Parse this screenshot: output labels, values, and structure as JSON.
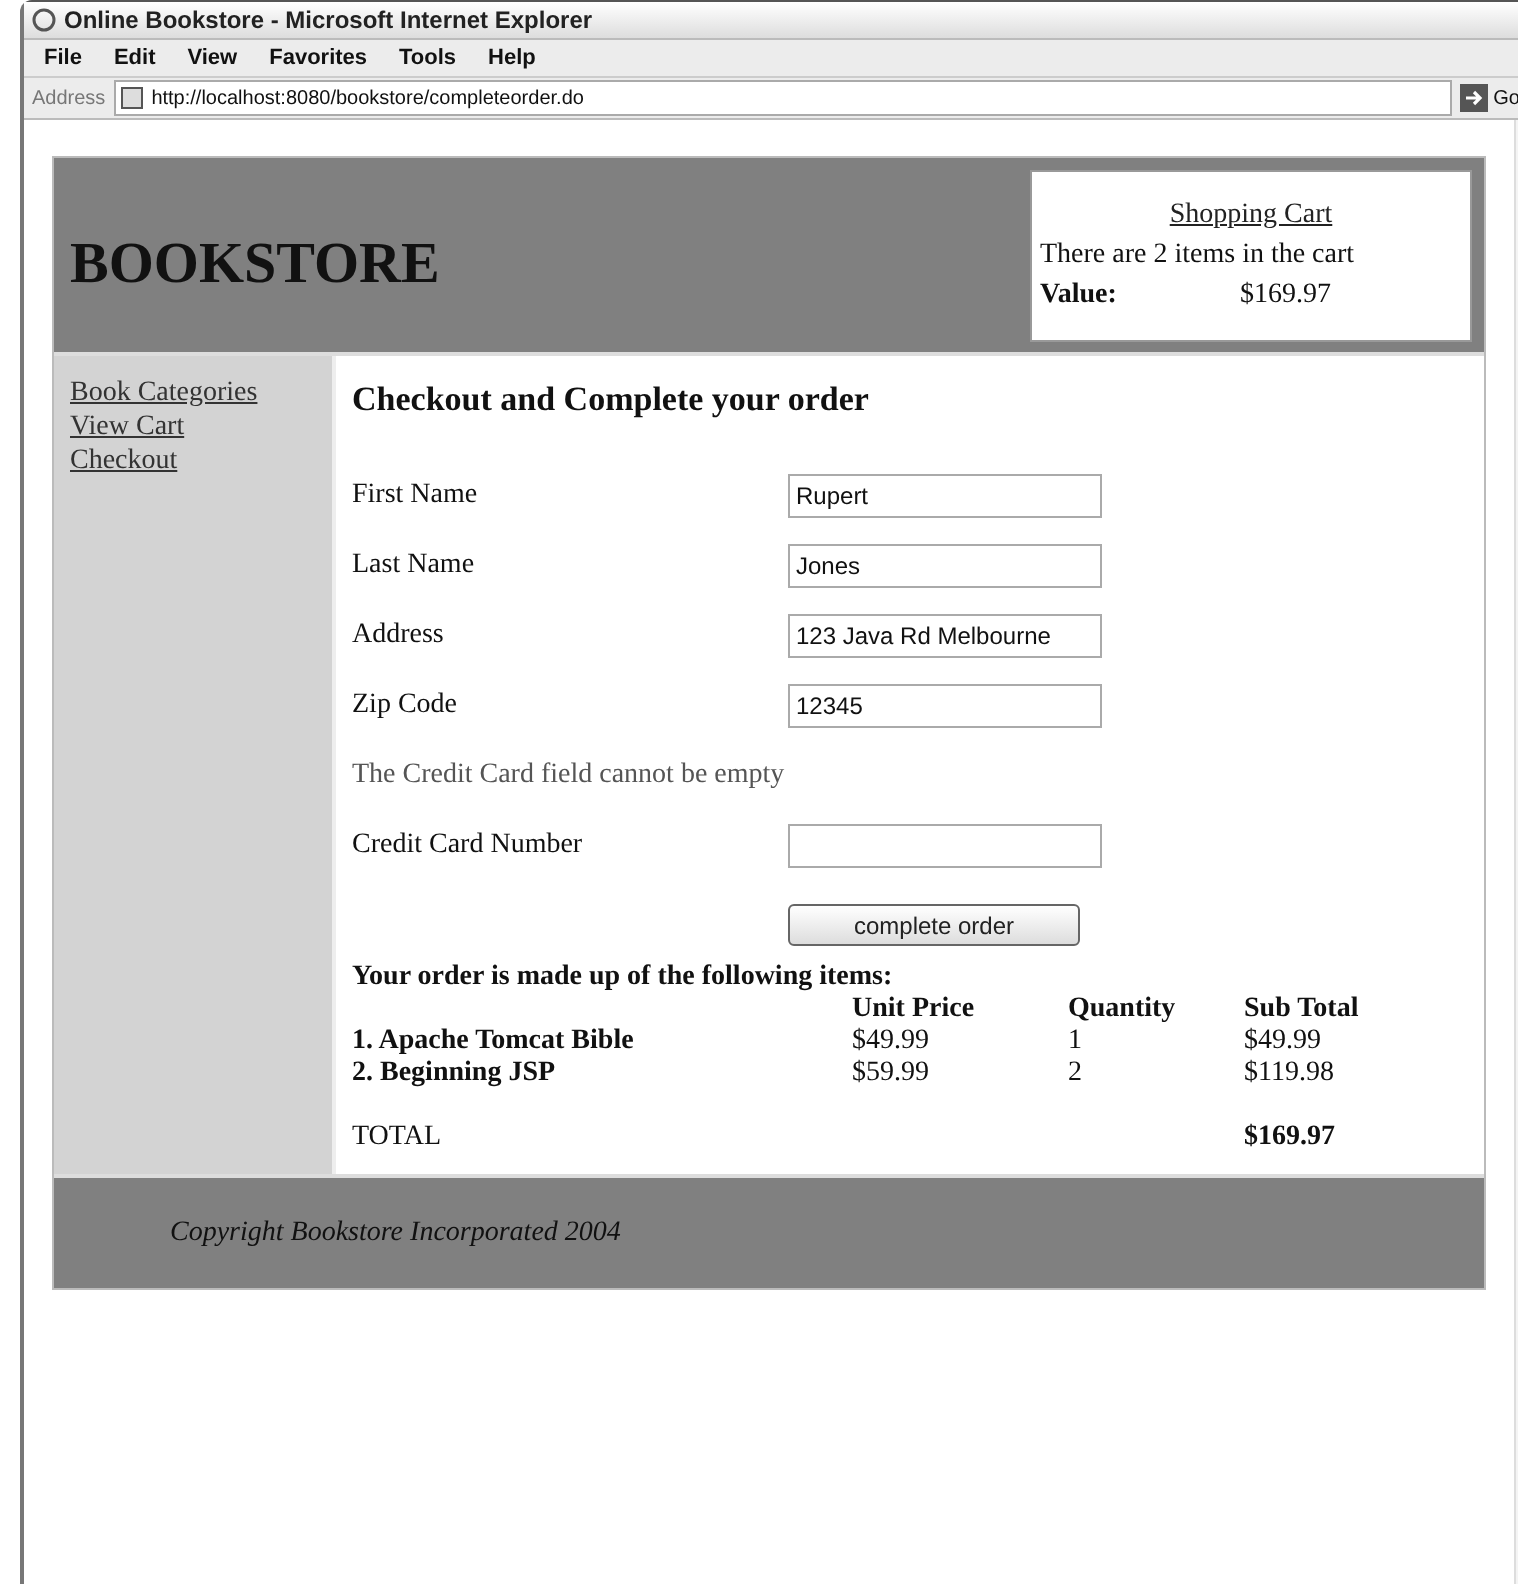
{
  "window": {
    "title": "Online Bookstore - Microsoft Internet Explorer"
  },
  "menu": [
    "File",
    "Edit",
    "View",
    "Favorites",
    "Tools",
    "Help"
  ],
  "address_bar": {
    "label": "Address",
    "url": "http://localhost:8080/bookstore/completeorder.do",
    "go": "Go"
  },
  "header": {
    "logo": "BOOKSTORE",
    "cart": {
      "title": "Shopping Cart",
      "summary": "There are 2 items in the cart",
      "value_label": "Value:",
      "value": "$169.97"
    }
  },
  "sidebar": {
    "links": [
      "Book Categories",
      "View Cart",
      "Checkout"
    ]
  },
  "checkout": {
    "heading": "Checkout and Complete your order",
    "rows": [
      {
        "kind": "field",
        "label": "First Name",
        "value": "Rupert"
      },
      {
        "kind": "field",
        "label": "Last Name",
        "value": "Jones"
      },
      {
        "kind": "field",
        "label": "Address",
        "value": "123 Java Rd Melbourne"
      },
      {
        "kind": "field",
        "label": "Zip Code",
        "value": "12345"
      },
      {
        "kind": "message",
        "label": "The Credit Card field cannot be empty"
      },
      {
        "kind": "field",
        "label": "Credit Card Number",
        "value": ""
      }
    ],
    "submit": "complete order"
  },
  "order": {
    "intro": "Your order is made up of the following items:",
    "columns": [
      "Unit Price",
      "Quantity",
      "Sub Total"
    ],
    "rows": [
      {
        "item": "1. Apache Tomcat Bible",
        "unit_price": "$49.99",
        "quantity": "1",
        "sub_total": "$49.99"
      },
      {
        "item": "2. Beginning JSP",
        "unit_price": "$59.99",
        "quantity": "2",
        "sub_total": "$119.98"
      }
    ],
    "total_label": "TOTAL",
    "total": "$169.97"
  },
  "footer": {
    "text": "Copyright Bookstore Incorporated 2004"
  }
}
